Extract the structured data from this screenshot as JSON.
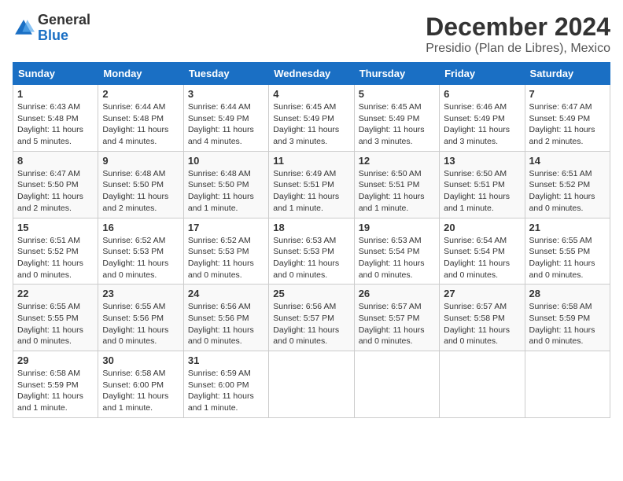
{
  "logo": {
    "general": "General",
    "blue": "Blue"
  },
  "title": "December 2024",
  "subtitle": "Presidio (Plan de Libres), Mexico",
  "days_header": [
    "Sunday",
    "Monday",
    "Tuesday",
    "Wednesday",
    "Thursday",
    "Friday",
    "Saturday"
  ],
  "weeks": [
    [
      {
        "day": "1",
        "sunrise": "6:43 AM",
        "sunset": "5:48 PM",
        "daylight": "11 hours and 5 minutes."
      },
      {
        "day": "2",
        "sunrise": "6:44 AM",
        "sunset": "5:48 PM",
        "daylight": "11 hours and 4 minutes."
      },
      {
        "day": "3",
        "sunrise": "6:44 AM",
        "sunset": "5:49 PM",
        "daylight": "11 hours and 4 minutes."
      },
      {
        "day": "4",
        "sunrise": "6:45 AM",
        "sunset": "5:49 PM",
        "daylight": "11 hours and 3 minutes."
      },
      {
        "day": "5",
        "sunrise": "6:45 AM",
        "sunset": "5:49 PM",
        "daylight": "11 hours and 3 minutes."
      },
      {
        "day": "6",
        "sunrise": "6:46 AM",
        "sunset": "5:49 PM",
        "daylight": "11 hours and 3 minutes."
      },
      {
        "day": "7",
        "sunrise": "6:47 AM",
        "sunset": "5:49 PM",
        "daylight": "11 hours and 2 minutes."
      }
    ],
    [
      {
        "day": "8",
        "sunrise": "6:47 AM",
        "sunset": "5:50 PM",
        "daylight": "11 hours and 2 minutes."
      },
      {
        "day": "9",
        "sunrise": "6:48 AM",
        "sunset": "5:50 PM",
        "daylight": "11 hours and 2 minutes."
      },
      {
        "day": "10",
        "sunrise": "6:48 AM",
        "sunset": "5:50 PM",
        "daylight": "11 hours and 1 minute."
      },
      {
        "day": "11",
        "sunrise": "6:49 AM",
        "sunset": "5:51 PM",
        "daylight": "11 hours and 1 minute."
      },
      {
        "day": "12",
        "sunrise": "6:50 AM",
        "sunset": "5:51 PM",
        "daylight": "11 hours and 1 minute."
      },
      {
        "day": "13",
        "sunrise": "6:50 AM",
        "sunset": "5:51 PM",
        "daylight": "11 hours and 1 minute."
      },
      {
        "day": "14",
        "sunrise": "6:51 AM",
        "sunset": "5:52 PM",
        "daylight": "11 hours and 0 minutes."
      }
    ],
    [
      {
        "day": "15",
        "sunrise": "6:51 AM",
        "sunset": "5:52 PM",
        "daylight": "11 hours and 0 minutes."
      },
      {
        "day": "16",
        "sunrise": "6:52 AM",
        "sunset": "5:53 PM",
        "daylight": "11 hours and 0 minutes."
      },
      {
        "day": "17",
        "sunrise": "6:52 AM",
        "sunset": "5:53 PM",
        "daylight": "11 hours and 0 minutes."
      },
      {
        "day": "18",
        "sunrise": "6:53 AM",
        "sunset": "5:53 PM",
        "daylight": "11 hours and 0 minutes."
      },
      {
        "day": "19",
        "sunrise": "6:53 AM",
        "sunset": "5:54 PM",
        "daylight": "11 hours and 0 minutes."
      },
      {
        "day": "20",
        "sunrise": "6:54 AM",
        "sunset": "5:54 PM",
        "daylight": "11 hours and 0 minutes."
      },
      {
        "day": "21",
        "sunrise": "6:55 AM",
        "sunset": "5:55 PM",
        "daylight": "11 hours and 0 minutes."
      }
    ],
    [
      {
        "day": "22",
        "sunrise": "6:55 AM",
        "sunset": "5:55 PM",
        "daylight": "11 hours and 0 minutes."
      },
      {
        "day": "23",
        "sunrise": "6:55 AM",
        "sunset": "5:56 PM",
        "daylight": "11 hours and 0 minutes."
      },
      {
        "day": "24",
        "sunrise": "6:56 AM",
        "sunset": "5:56 PM",
        "daylight": "11 hours and 0 minutes."
      },
      {
        "day": "25",
        "sunrise": "6:56 AM",
        "sunset": "5:57 PM",
        "daylight": "11 hours and 0 minutes."
      },
      {
        "day": "26",
        "sunrise": "6:57 AM",
        "sunset": "5:57 PM",
        "daylight": "11 hours and 0 minutes."
      },
      {
        "day": "27",
        "sunrise": "6:57 AM",
        "sunset": "5:58 PM",
        "daylight": "11 hours and 0 minutes."
      },
      {
        "day": "28",
        "sunrise": "6:58 AM",
        "sunset": "5:59 PM",
        "daylight": "11 hours and 0 minutes."
      }
    ],
    [
      {
        "day": "29",
        "sunrise": "6:58 AM",
        "sunset": "5:59 PM",
        "daylight": "11 hours and 1 minute."
      },
      {
        "day": "30",
        "sunrise": "6:58 AM",
        "sunset": "6:00 PM",
        "daylight": "11 hours and 1 minute."
      },
      {
        "day": "31",
        "sunrise": "6:59 AM",
        "sunset": "6:00 PM",
        "daylight": "11 hours and 1 minute."
      },
      null,
      null,
      null,
      null
    ]
  ],
  "labels": {
    "sunrise": "Sunrise:",
    "sunset": "Sunset:",
    "daylight": "Daylight:"
  }
}
